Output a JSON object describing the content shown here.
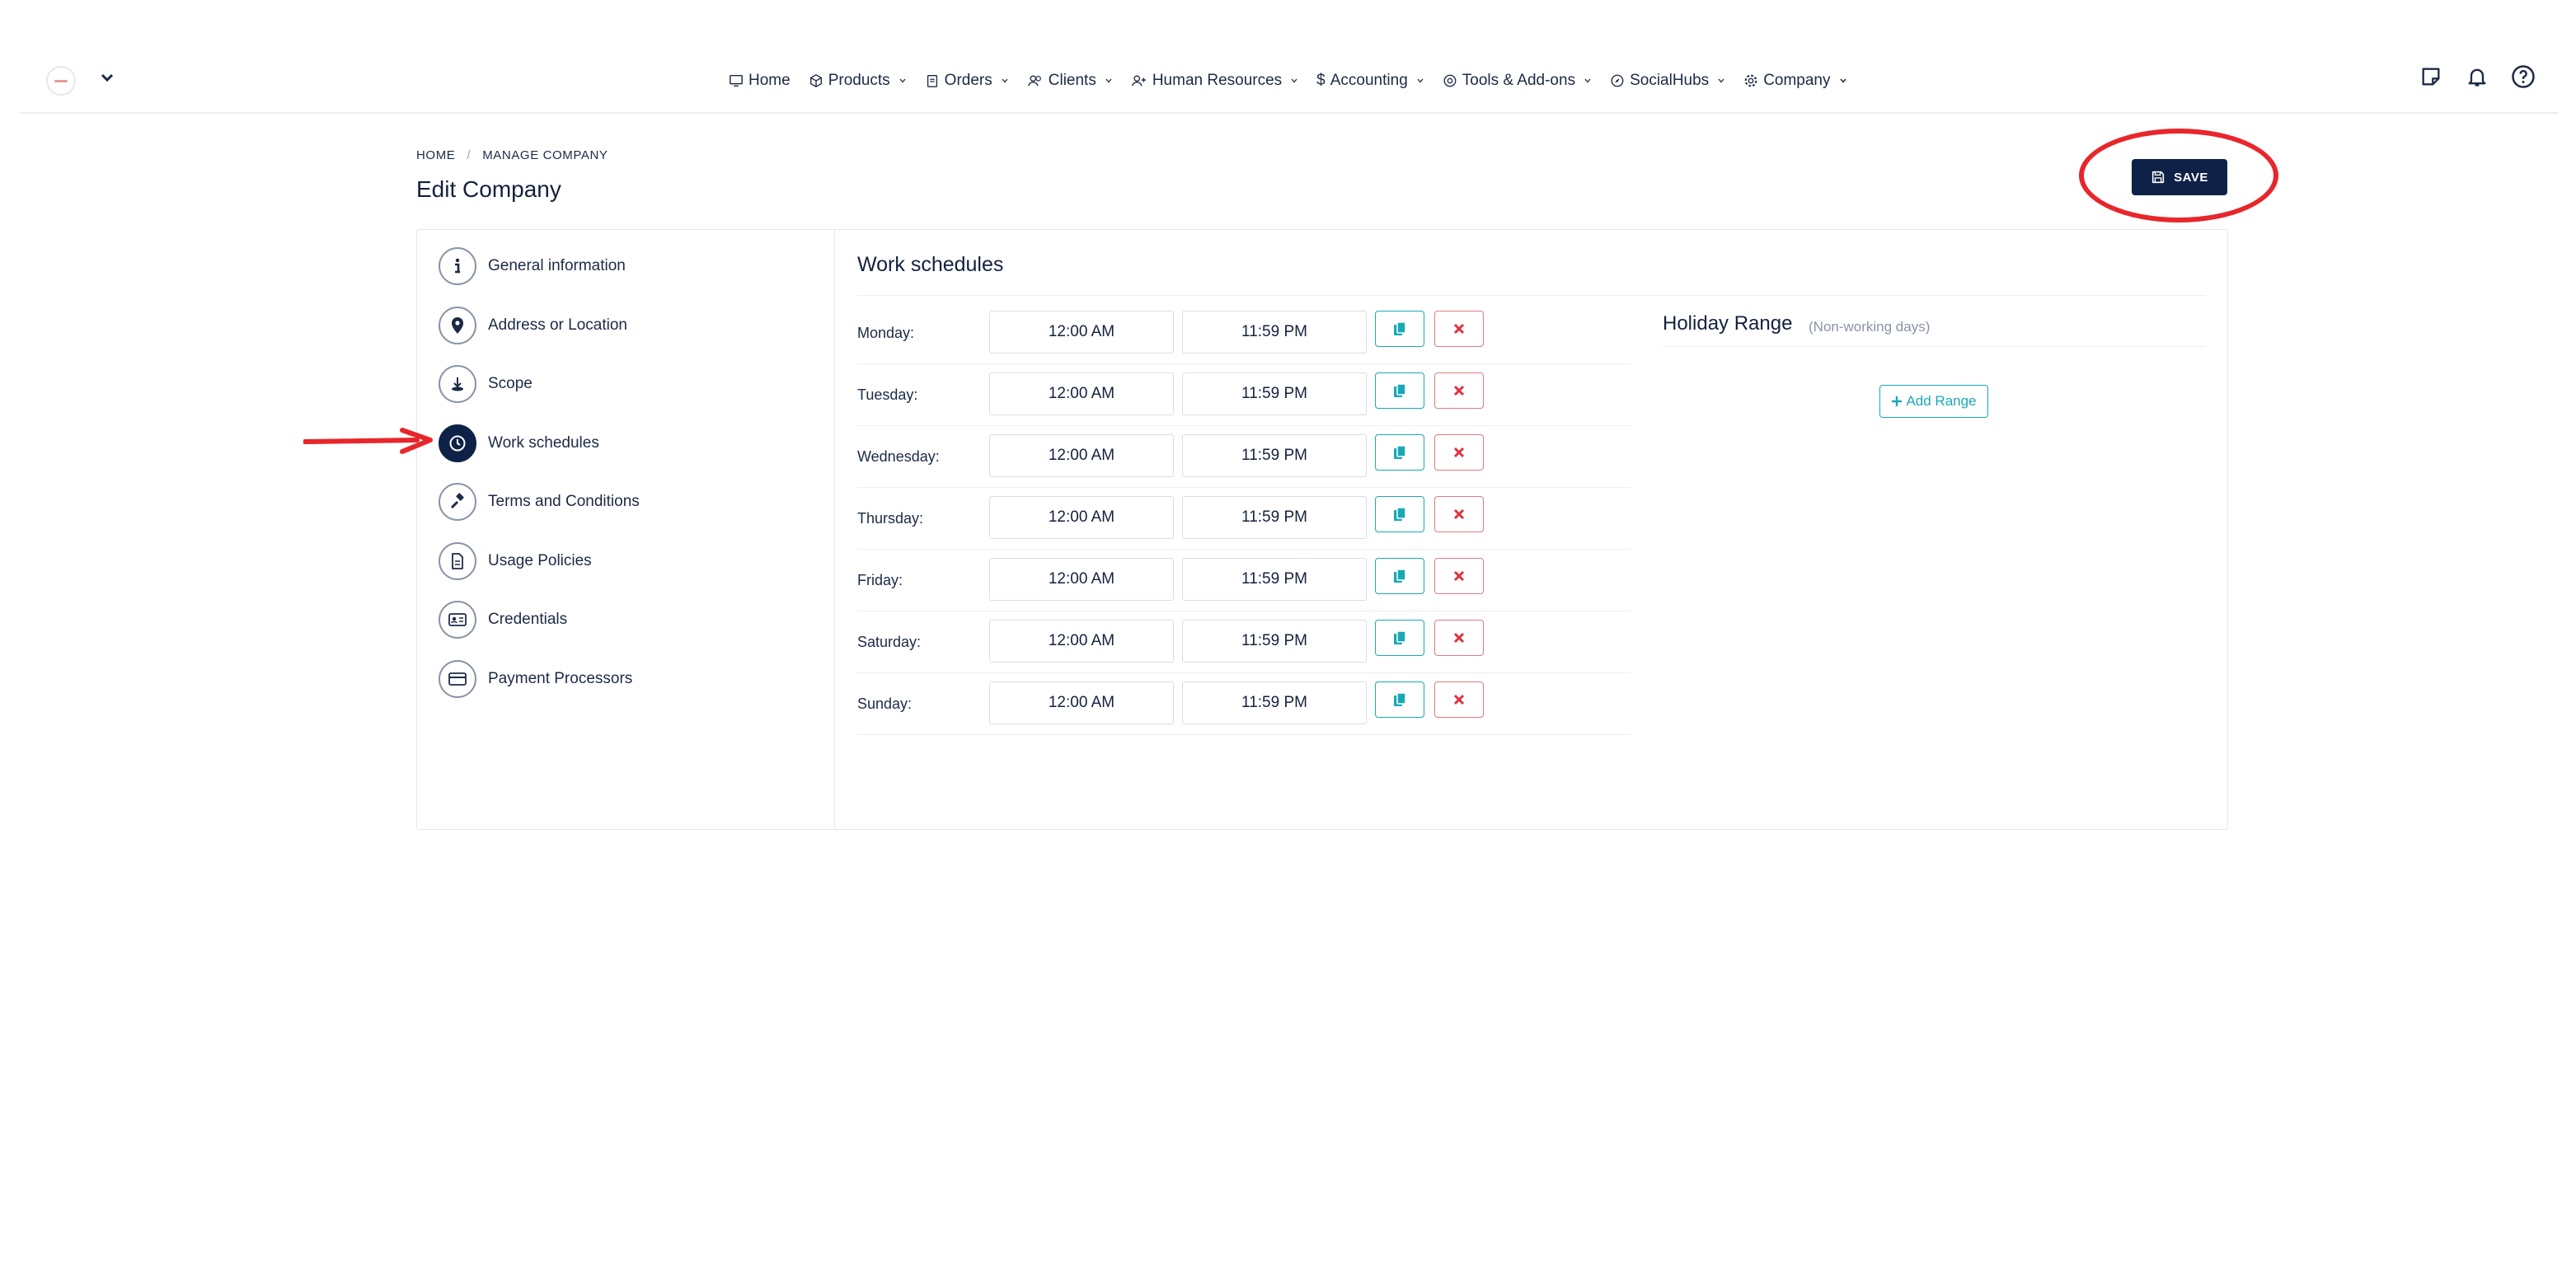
{
  "nav": {
    "items": [
      {
        "label": "Home",
        "icon": "monitor-icon",
        "caret": false
      },
      {
        "label": "Products",
        "icon": "box-icon",
        "caret": true
      },
      {
        "label": "Orders",
        "icon": "clipboard-icon",
        "caret": true
      },
      {
        "label": "Clients",
        "icon": "users-icon",
        "caret": true
      },
      {
        "label": "Human Resources",
        "icon": "user-plus-icon",
        "caret": true
      },
      {
        "label": "Accounting",
        "icon": "dollar-icon",
        "caret": true
      },
      {
        "label": "Tools & Add-ons",
        "icon": "at-icon",
        "caret": true
      },
      {
        "label": "SocialHubs",
        "icon": "compass-icon",
        "caret": true
      },
      {
        "label": "Company",
        "icon": "gear-icon",
        "caret": true
      }
    ]
  },
  "breadcrumb": {
    "home": "HOME",
    "separator": "/",
    "current": "MANAGE COMPANY"
  },
  "page": {
    "title": "Edit Company",
    "save_label": "SAVE"
  },
  "sidebar": {
    "items": [
      {
        "label": "General information",
        "icon": "info-icon"
      },
      {
        "label": "Address or Location",
        "icon": "map-pin-icon"
      },
      {
        "label": "Scope",
        "icon": "scope-icon"
      },
      {
        "label": "Work schedules",
        "icon": "clock-icon",
        "active": true
      },
      {
        "label": "Terms and Conditions",
        "icon": "gavel-icon"
      },
      {
        "label": "Usage Policies",
        "icon": "document-icon"
      },
      {
        "label": "Credentials",
        "icon": "id-card-icon"
      },
      {
        "label": "Payment Processors",
        "icon": "credit-card-icon"
      }
    ]
  },
  "schedule": {
    "title": "Work schedules",
    "days": [
      {
        "day": "Monday:",
        "start": "12:00 AM",
        "end": "11:59 PM"
      },
      {
        "day": "Tuesday:",
        "start": "12:00 AM",
        "end": "11:59 PM"
      },
      {
        "day": "Wednesday:",
        "start": "12:00 AM",
        "end": "11:59 PM"
      },
      {
        "day": "Thursday:",
        "start": "12:00 AM",
        "end": "11:59 PM"
      },
      {
        "day": "Friday:",
        "start": "12:00 AM",
        "end": "11:59 PM"
      },
      {
        "day": "Saturday:",
        "start": "12:00 AM",
        "end": "11:59 PM"
      },
      {
        "day": "Sunday:",
        "start": "12:00 AM",
        "end": "11:59 PM"
      }
    ]
  },
  "holiday": {
    "title": "Holiday Range",
    "subtitle": "(Non-working days)",
    "add_label": "Add Range"
  },
  "colors": {
    "primary": "#0e2247",
    "accent": "#19a9b6",
    "danger": "#e0313b",
    "annotation": "#e8262b"
  }
}
